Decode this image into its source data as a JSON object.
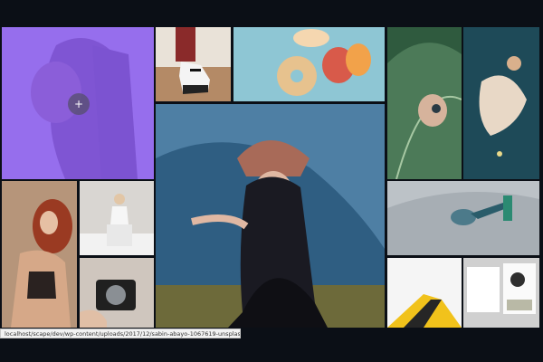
{
  "gallery": {
    "background_color": "#0b0f16",
    "hover_overlay_color": "#8b5cf6",
    "hover_icon": "plus-icon",
    "hover_icon_glyph": "+",
    "tiles": [
      {
        "name": "portrait-braids",
        "hovered": true
      },
      {
        "name": "sneakers"
      },
      {
        "name": "donuts"
      },
      {
        "name": "leaf-eye"
      },
      {
        "name": "underwater-dress"
      },
      {
        "name": "crowned-woman-featured"
      },
      {
        "name": "red-hair-woman"
      },
      {
        "name": "woman-stool"
      },
      {
        "name": "hand-camera"
      },
      {
        "name": "skateboarder"
      },
      {
        "name": "yellow-building"
      },
      {
        "name": "magazine-pages"
      }
    ]
  },
  "status_bar": {
    "url": "localhost/scape/dev/wp-content/uploads/2017/12/sabin-abayo-1067619-unsplash.jpg"
  }
}
